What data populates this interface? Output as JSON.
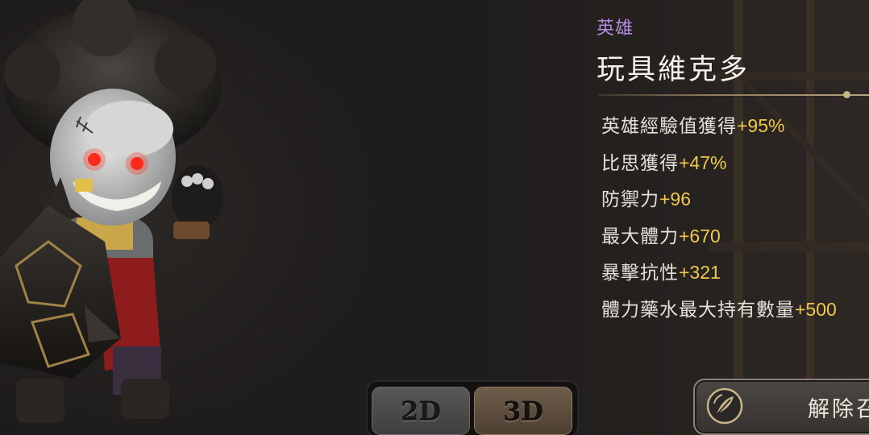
{
  "hero": {
    "category": "英雄",
    "name": "玩具維克多"
  },
  "stats": [
    {
      "label": "英雄經驗值獲得",
      "value": "+95%"
    },
    {
      "label": "比思獲得",
      "value": "+47%"
    },
    {
      "label": "防禦力",
      "value": "+96"
    },
    {
      "label": "最大體力",
      "value": "+670"
    },
    {
      "label": "暴擊抗性",
      "value": "+321"
    },
    {
      "label": "體力藥水最大持有數量",
      "value": "+500"
    }
  ],
  "view_toggle": {
    "option_2d": "2D",
    "option_3d": "3D",
    "selected": "3D"
  },
  "unequip_button": {
    "label": "解除召",
    "icon": "feather-quill-icon"
  },
  "colors": {
    "category": "#b58ce0",
    "name": "#f5f2ec",
    "stat_label": "#e4e0d8",
    "stat_value": "#f0c84a"
  }
}
